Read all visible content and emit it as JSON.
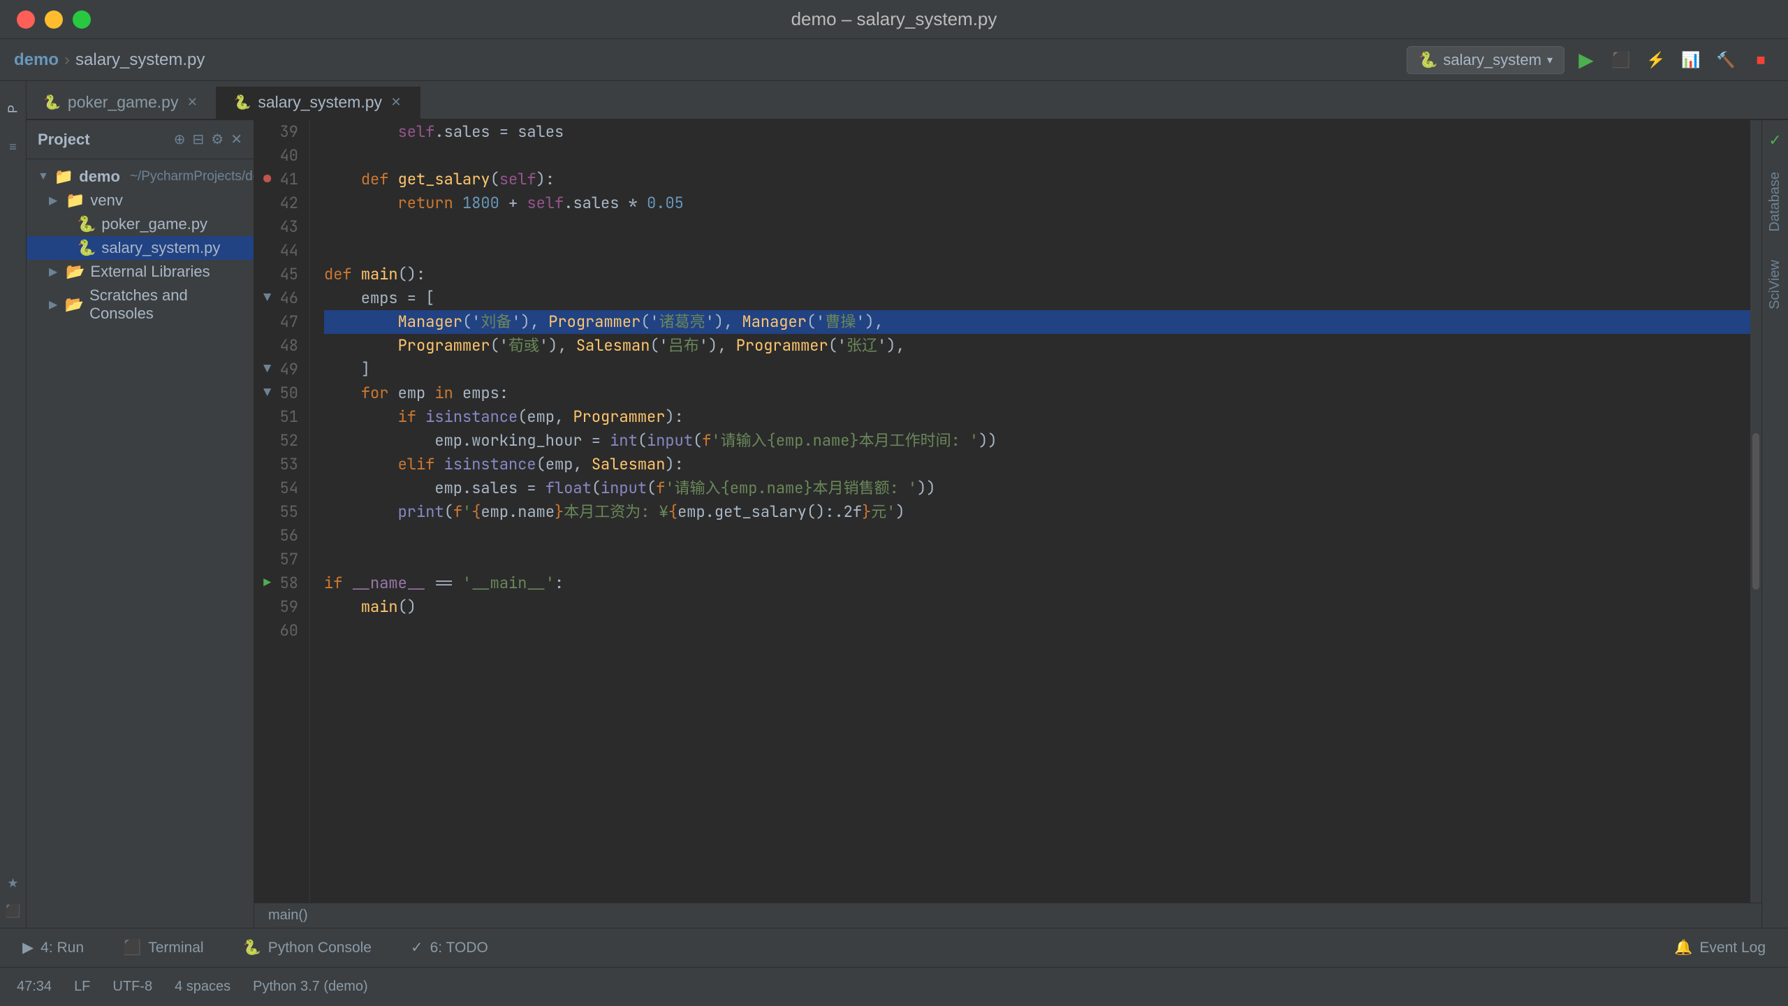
{
  "window": {
    "title": "demo – salary_system.py",
    "buttons": [
      "close",
      "minimize",
      "maximize"
    ]
  },
  "breadcrumb": {
    "project": "demo",
    "file": "salary_system.py"
  },
  "toolbar": {
    "run_config": "salary_system",
    "run_label": "▶",
    "stop_label": "■"
  },
  "tabs": [
    {
      "label": "poker_game.py",
      "icon": "🐍",
      "active": false,
      "closeable": true
    },
    {
      "label": "salary_system.py",
      "icon": "🐍",
      "active": true,
      "closeable": true
    }
  ],
  "file_tree": {
    "panel_title": "Project",
    "items": [
      {
        "label": "demo",
        "type": "root_folder",
        "path": "~/PycharmProjects/demo",
        "expanded": true,
        "indent": 0
      },
      {
        "label": "venv",
        "type": "folder",
        "expanded": false,
        "indent": 1
      },
      {
        "label": "poker_game.py",
        "type": "python",
        "indent": 2
      },
      {
        "label": "salary_system.py",
        "type": "python_active",
        "indent": 2
      },
      {
        "label": "External Libraries",
        "type": "folder_closed",
        "indent": 1
      },
      {
        "label": "Scratches and Consoles",
        "type": "folder_closed",
        "indent": 1
      }
    ]
  },
  "code": {
    "lines": [
      {
        "num": 39,
        "content": "        self.sales = sales",
        "type": "normal"
      },
      {
        "num": 40,
        "content": "",
        "type": "normal"
      },
      {
        "num": 41,
        "content": "    def get_salary(self):",
        "type": "normal",
        "has_bp": true
      },
      {
        "num": 42,
        "content": "        return 1800 + self.sales * 0.05",
        "type": "normal"
      },
      {
        "num": 43,
        "content": "",
        "type": "normal"
      },
      {
        "num": 44,
        "content": "",
        "type": "normal"
      },
      {
        "num": 45,
        "content": "def main():",
        "type": "normal"
      },
      {
        "num": 46,
        "content": "    emps = [",
        "type": "normal",
        "foldable": true
      },
      {
        "num": 47,
        "content": "        Manager('刘备'), Programmer('诸葛亮'), Manager('曹操'),",
        "type": "selected"
      },
      {
        "num": 48,
        "content": "        Programmer('荀彧'), Salesman('吕布'), Programmer('张辽'),",
        "type": "normal"
      },
      {
        "num": 49,
        "content": "    ]",
        "type": "normal",
        "foldable": true
      },
      {
        "num": 50,
        "content": "    for emp in emps:",
        "type": "normal",
        "foldable": true
      },
      {
        "num": 51,
        "content": "        if isinstance(emp, Programmer):",
        "type": "normal"
      },
      {
        "num": 52,
        "content": "            emp.working_hour = int(input(f'请输入{emp.name}本月工作时间: '))",
        "type": "normal"
      },
      {
        "num": 53,
        "content": "        elif isinstance(emp, Salesman):",
        "type": "normal"
      },
      {
        "num": 54,
        "content": "            emp.sales = float(input(f'请输入{emp.name}本月销售额: '))",
        "type": "normal"
      },
      {
        "num": 55,
        "content": "        print(f'{emp.name}本月工资为: ¥{emp.get_salary():.2f}元')",
        "type": "normal"
      },
      {
        "num": 56,
        "content": "",
        "type": "normal"
      },
      {
        "num": 57,
        "content": "",
        "type": "normal"
      },
      {
        "num": 58,
        "content": "if __name__ == '__main__':",
        "type": "normal",
        "has_run": true
      },
      {
        "num": 59,
        "content": "    main()",
        "type": "normal"
      },
      {
        "num": 60,
        "content": "",
        "type": "normal"
      }
    ],
    "footer": "main()"
  },
  "bottom_tabs": [
    {
      "label": "4: Run",
      "icon": "▶"
    },
    {
      "label": "Terminal",
      "icon": "⬛"
    },
    {
      "label": "Python Console",
      "icon": "🐍"
    },
    {
      "label": "6: TODO",
      "icon": "✓"
    }
  ],
  "status_bar": {
    "position": "47:34",
    "line_sep": "LF",
    "encoding": "UTF-8",
    "indent": "4 spaces",
    "python": "Python 3.7 (demo)",
    "event_log": "Event Log"
  },
  "right_tabs": [
    "Database",
    "SciView"
  ]
}
